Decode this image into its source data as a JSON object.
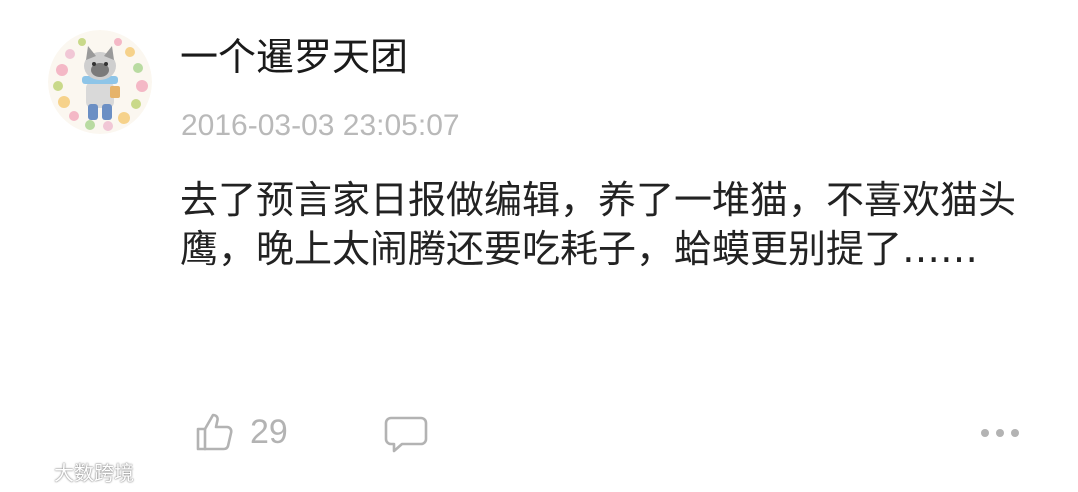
{
  "comment": {
    "author": "一个暹罗天团",
    "timestamp": "2016-03-03 23:05:07",
    "body": "去了预言家日报做编辑，养了一堆猫，不喜欢猫头鹰，晚上太闹腾还要吃耗子，蛤蟆更别提了……",
    "likes": "29"
  },
  "icons": {
    "avatar": "avatar-cat-character",
    "like": "thumbs-up-icon",
    "comment": "speech-bubble-icon",
    "more": "ellipsis-icon"
  },
  "watermark": {
    "text": "大数跨境"
  },
  "colors": {
    "text_primary": "#222222",
    "text_secondary": "#b9b9b9",
    "icon_gray": "#b3b3b3"
  }
}
